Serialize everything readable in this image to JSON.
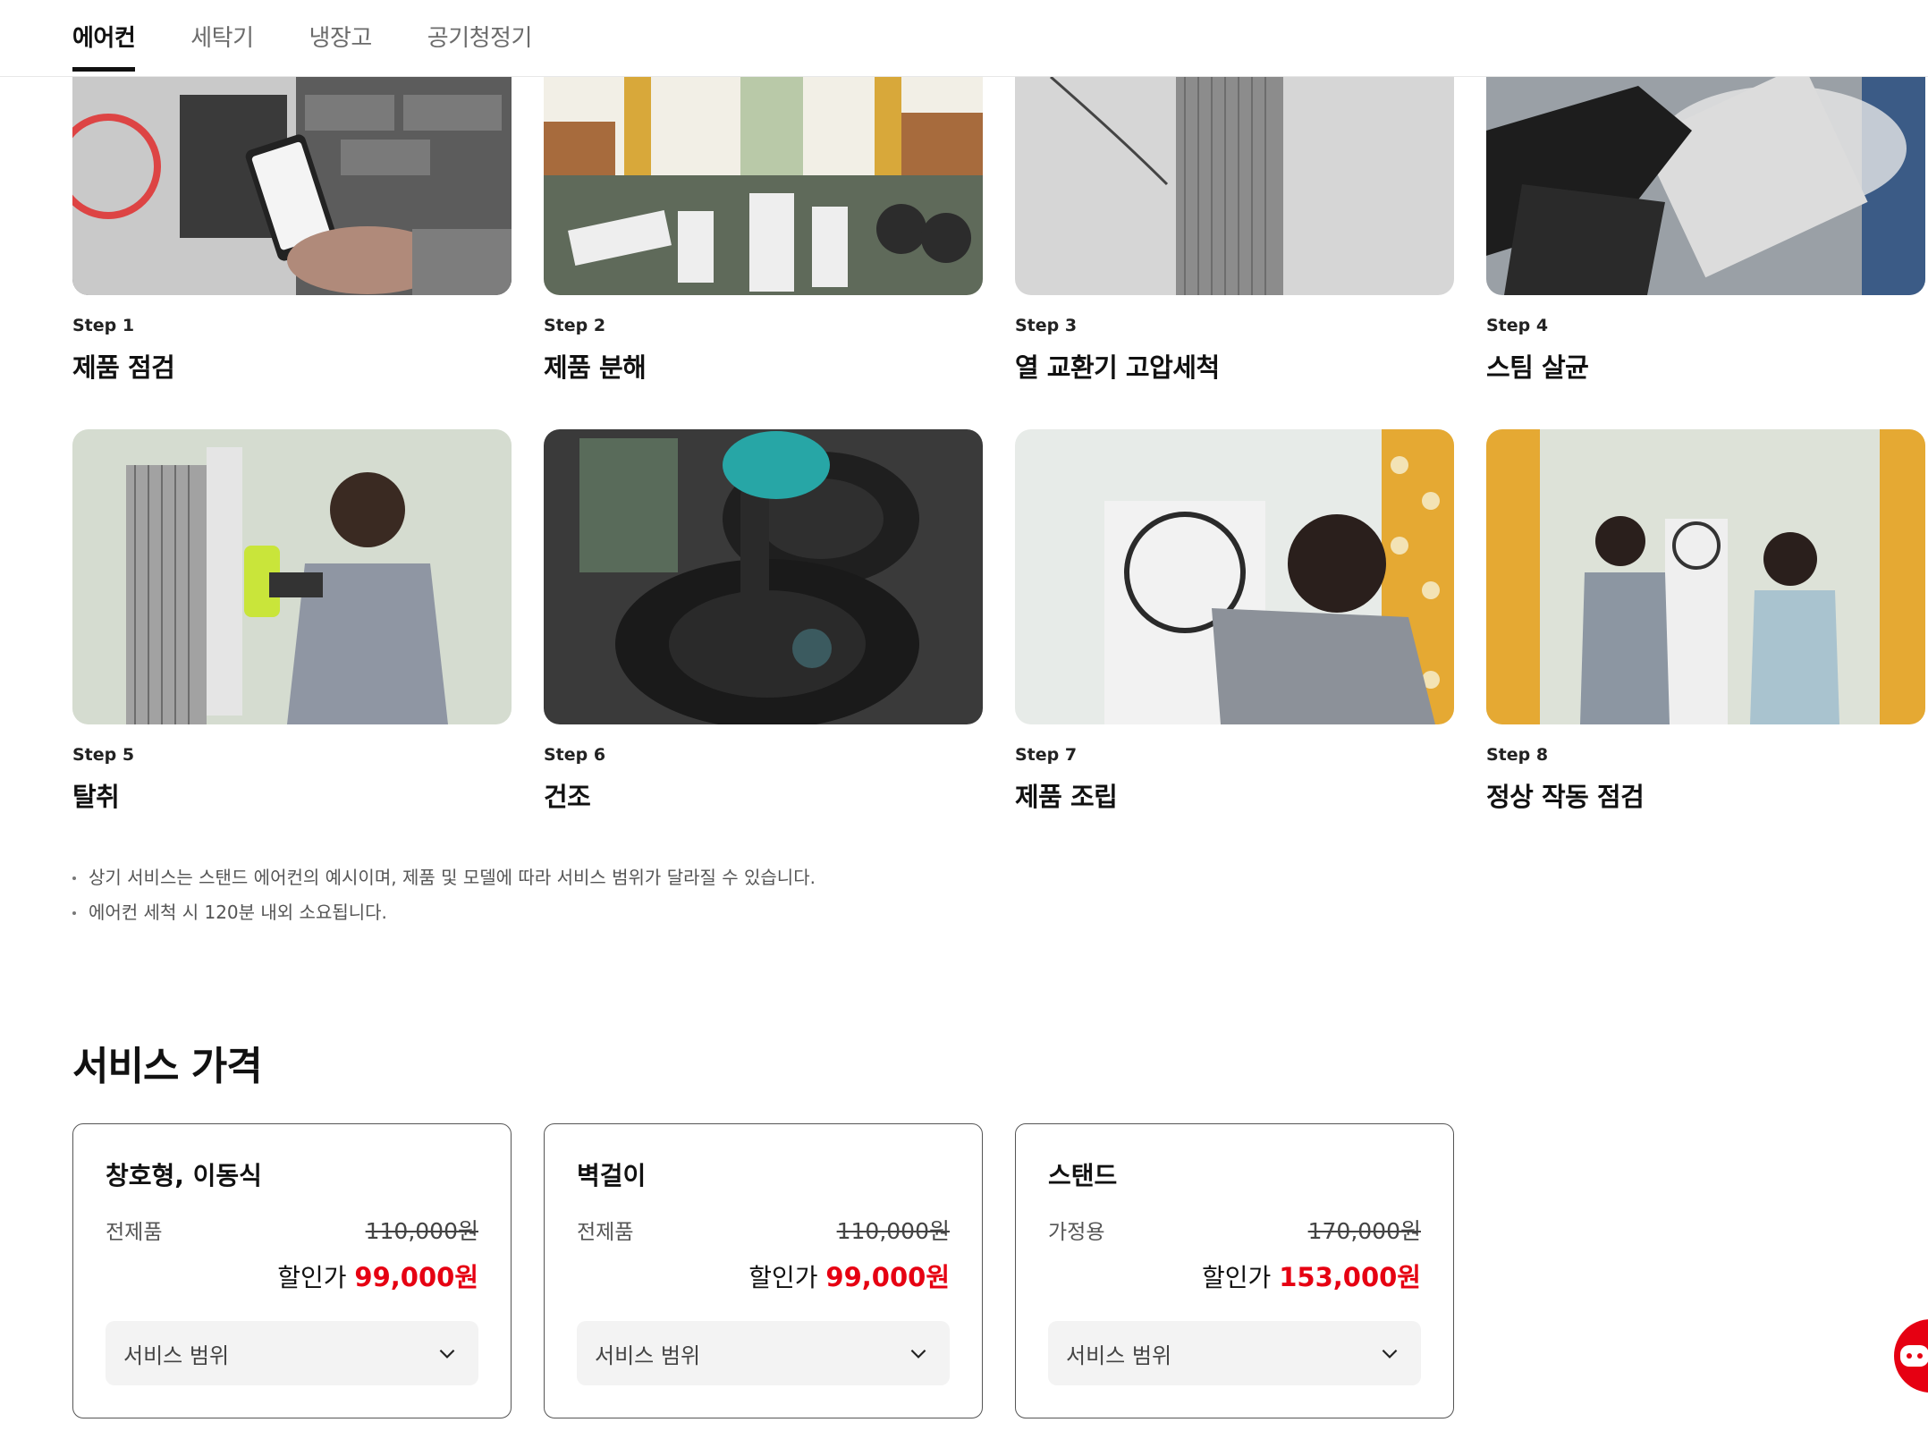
{
  "tabs": [
    {
      "label": "에어컨",
      "active": true
    },
    {
      "label": "세탁기",
      "active": false
    },
    {
      "label": "냉장고",
      "active": false
    },
    {
      "label": "공기청정기",
      "active": false
    }
  ],
  "steps": [
    {
      "num": "Step 1",
      "title": "제품 점검",
      "image": "technician-inspecting-outdoor-unit-with-phone"
    },
    {
      "num": "Step 2",
      "title": "제품 분해",
      "image": "disassembled-parts-on-floor"
    },
    {
      "num": "Step 3",
      "title": "열 교환기 고압세척",
      "image": "heat-exchanger-pressure-wash"
    },
    {
      "num": "Step 4",
      "title": "스팀 살균",
      "image": "steam-sterilization"
    },
    {
      "num": "Step 5",
      "title": "탈취",
      "image": "deodorizing-spray"
    },
    {
      "num": "Step 6",
      "title": "건조",
      "image": "blower-drying-fan"
    },
    {
      "num": "Step 7",
      "title": "제품 조립",
      "image": "reassembling-front-panel"
    },
    {
      "num": "Step 8",
      "title": "정상 작동 점검",
      "image": "final-operation-check"
    }
  ],
  "notes": [
    "상기 서비스는 스탠드 에어컨의 예시이며, 제품 및 모델에 따라 서비스 범위가 달라질 수 있습니다.",
    "에어컨 세척 시 120분 내외 소요됩니다."
  ],
  "pricing": {
    "title": "서비스 가격",
    "cards": [
      {
        "title": "창호형, 이동식",
        "category": "전제품",
        "original_price": "110,000원",
        "discount_label": "할인가",
        "sale_price": "99,000원",
        "dropdown_label": "서비스 범위"
      },
      {
        "title": "벽걸이",
        "category": "전제품",
        "original_price": "110,000원",
        "discount_label": "할인가",
        "sale_price": "99,000원",
        "dropdown_label": "서비스 범위"
      },
      {
        "title": "스탠드",
        "category": "가정용",
        "original_price": "170,000원",
        "discount_label": "할인가",
        "sale_price": "153,000원",
        "dropdown_label": "서비스 범위"
      }
    ]
  },
  "colors": {
    "accent": "#e60012",
    "text": "#111111",
    "muted": "#555555"
  },
  "icons": {
    "dropdown": "chevron-down-icon",
    "chatbot": "chatbot-icon"
  }
}
